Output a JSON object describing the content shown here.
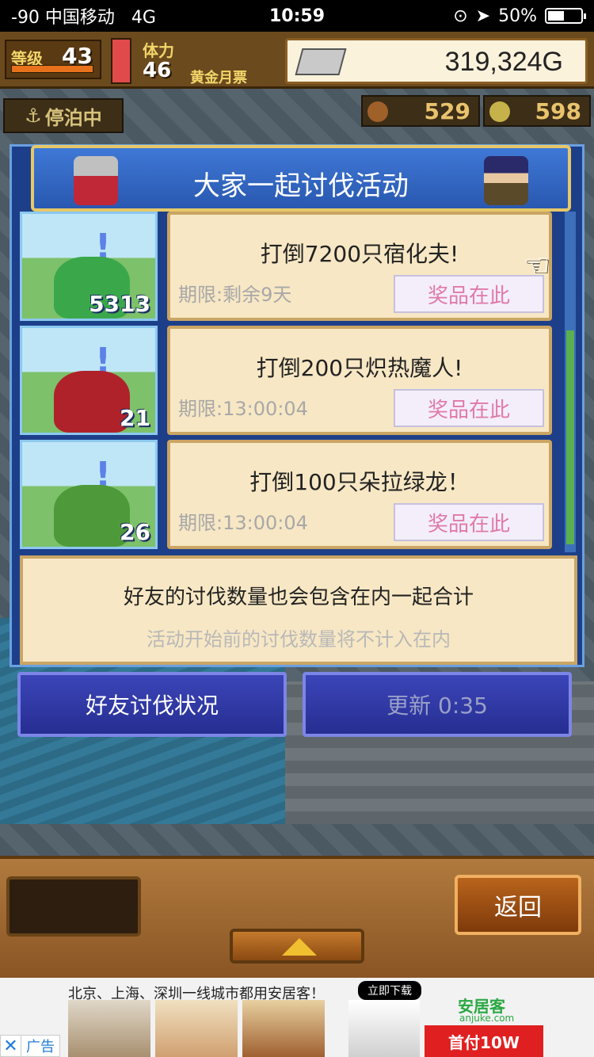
{
  "statusbar": {
    "carrier": "-90 中国移动",
    "network": "4G",
    "time": "10:59",
    "battery": "50%",
    "battery_level": 0.5
  },
  "hud": {
    "level_label": "等级",
    "level": "43",
    "stamina_label": "体力",
    "stamina": "46",
    "pass_label": "黄金月票",
    "gold": "319,324G",
    "anchored_label": "停泊中",
    "res1": "529",
    "res2": "598"
  },
  "panel": {
    "title": "大家一起讨伐活动",
    "tasks": [
      {
        "title": "打倒7200只宿化夫!",
        "deadline": "期限:剩余9天",
        "prize": "奖品在此",
        "count": "5313",
        "monster_color": "#3aa84a"
      },
      {
        "title": "打倒200只炽热魔人!",
        "deadline": "期限:13:00:04",
        "prize": "奖品在此",
        "count": "21",
        "monster_color": "#b0222a"
      },
      {
        "title": "打倒100只朵拉绿龙！",
        "deadline": "期限:13:00:04",
        "prize": "奖品在此",
        "count": "26",
        "monster_color": "#4e9a3a"
      }
    ],
    "note_main": "好友的讨伐数量也会包含在内一起合计",
    "note_sub": "活动开始前的讨伐数量将不计入在内"
  },
  "buttons": {
    "friends": "好友讨伐状况",
    "refresh": "更新 0:35",
    "back": "返回"
  },
  "ad": {
    "text": "北京、上海、深圳一线城市都用安居客！",
    "download": "立即下载",
    "brand": "安居客",
    "brand_url": "anjuke.com",
    "cta": "首付10W",
    "close": "✕",
    "tag": "广告"
  }
}
